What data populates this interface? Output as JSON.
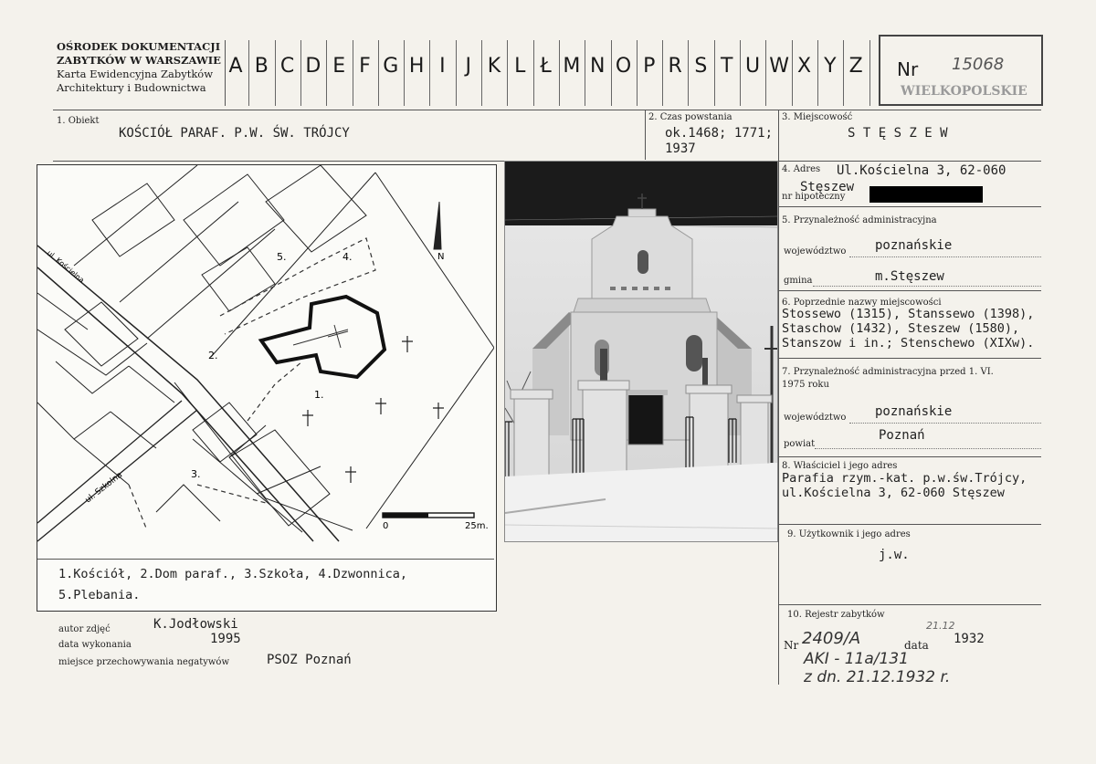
{
  "header": {
    "org_line1": "OŚRODEK DOKUMENTACJI",
    "org_line2": "ZABYTKÓW W WARSZAWIE",
    "org_line3": "Karta Ewidencyjna Zabytków",
    "org_line4": "Architektury i Budownictwa",
    "letters": [
      "A",
      "B",
      "C",
      "D",
      "E",
      "F",
      "G",
      "H",
      "I",
      "J",
      "K",
      "L",
      "Ł",
      "M",
      "N",
      "O",
      "P",
      "R",
      "S",
      "T",
      "U",
      "W",
      "X",
      "Y",
      "Z"
    ],
    "nr_label": "Nr",
    "nr_value": "15068",
    "stamp": "WIELKOPOLSKIE"
  },
  "fields": {
    "obiekt_label": "1. Obiekt",
    "obiekt_value": "KOŚCIÓŁ PARAF. P.W. ŚW. TRÓJCY",
    "czas_label": "2. Czas powstania",
    "czas_value_1": "ok.1468; 1771;",
    "czas_value_2": "1937",
    "miejscowosc_label": "3. Miejscowość",
    "miejscowosc_value": "S T Ę S Z E W",
    "adres_label": "4. Adres",
    "adres_value_1": "Ul.Kościelna 3, 62-060",
    "adres_value_2": "Stęszew",
    "hipoteczny_label": "nr hipoteczny",
    "przynaleznosc_label": "5. Przynależność administracyjna",
    "wojewodztwo_label": "województwo",
    "wojewodztwo_value": "poznańskie",
    "gmina_label": "gmina",
    "gmina_value": "m.Stęszew",
    "poprzednie_label": "6. Poprzednie nazwy miejscowości",
    "poprzednie_1": "Stossewo (1315), Stanssewo (1398),",
    "poprzednie_2": "Staschow (1432), Steszew (1580),",
    "poprzednie_3": "Stanszow i in.; Stenschewo (XIXw).",
    "przed_label_1": "7. Przynależność administracyjna przed 1. VI.",
    "przed_label_2": "1975 roku",
    "woj2_label": "województwo",
    "woj2_value": "poznańskie",
    "powiat_label": "powiat",
    "powiat_value": "Poznań",
    "wlasciciel_label": "8. Właściciel i jego adres",
    "wlasciciel_1": "Parafia rzym.-kat. p.w.św.Trójcy,",
    "wlasciciel_2": "ul.Kościelna 3, 62-060 Stęszew",
    "uzytkownik_label": "9. Użytkownik i jego adres",
    "uzytkownik_value": "j.w.",
    "rejestr_label": "10. Rejestr zabytków",
    "rejestr_nr_label": "Nr",
    "rejestr_nr_value": "2409/A",
    "rejestr_data_label": "data",
    "rejestr_data_value": "1932",
    "rejestr_data_hand": "21.12",
    "rejestr_hand_1": "AKI - 11a/131",
    "rejestr_hand_2": "z dn. 21.12.1932 r."
  },
  "map": {
    "legend_1": "1.Kościół, 2.Dom paraf., 3.Szkoła, 4.Dzwonnica,",
    "legend_2": "5.Plebania.",
    "street_1": "ul. Kościelna",
    "street_2": "ul. Szkolna",
    "scale_0": "0",
    "scale_25": "25m.",
    "north": "N",
    "num_1": "1.",
    "num_2": "2.",
    "num_3": "3.",
    "num_4": "4.",
    "num_5": "5."
  },
  "footer": {
    "autor_label": "autor zdjęć",
    "autor_value": "K.Jodłowski",
    "data_label": "data wykonania",
    "data_value": "1995",
    "miejsce_label": "miejsce przechowywania negatywów",
    "miejsce_value": "PSOZ Poznań"
  }
}
